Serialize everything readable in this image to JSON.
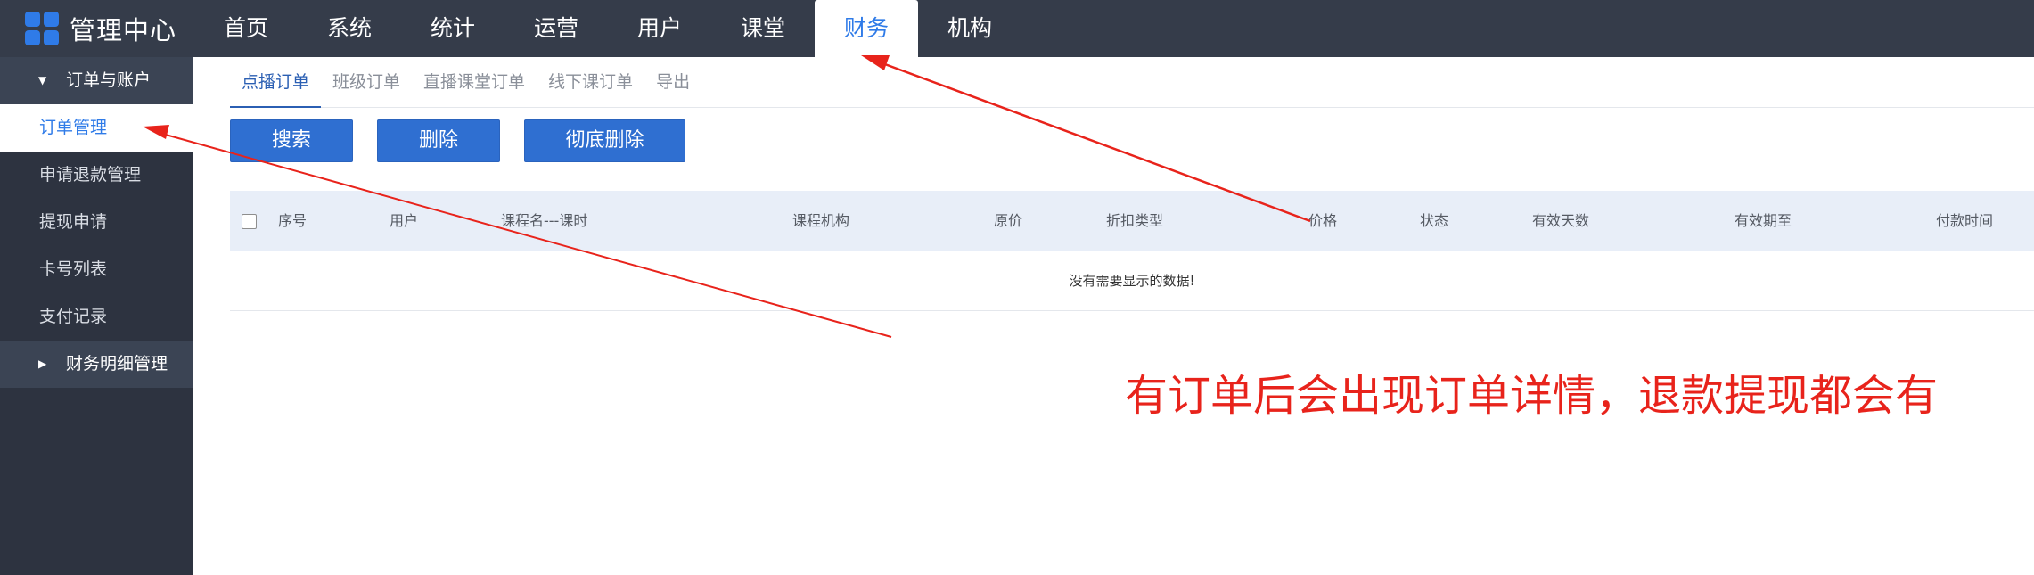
{
  "header": {
    "brand_title": "管理中心",
    "brand_icon": "app-grid-icon",
    "nav": [
      "首页",
      "系统",
      "统计",
      "运营",
      "用户",
      "课堂",
      "财务",
      "机构"
    ],
    "active_nav": "财务"
  },
  "sidebar": {
    "group_open": "订单与账户",
    "items": [
      "订单管理",
      "申请退款管理",
      "提现申请",
      "卡号列表",
      "支付记录"
    ],
    "active_item": "订单管理",
    "group_closed": "财务明细管理"
  },
  "tabs": [
    "点播订单",
    "班级订单",
    "直播课堂订单",
    "线下课订单",
    "导出"
  ],
  "active_tab": "点播订单",
  "actions": {
    "search": "搜索",
    "delete": "删除",
    "purge": "彻底删除"
  },
  "table": {
    "columns": [
      "序号",
      "用户",
      "课程名---课时",
      "课程机构",
      "原价",
      "折扣类型",
      "价格",
      "状态",
      "有效天数",
      "有效期至",
      "付款时间"
    ],
    "empty_text": "没有需要显示的数据!"
  },
  "annotation": {
    "text": "有订单后会出现订单详情，退款提现都会有",
    "color": "#e8231b"
  },
  "colors": {
    "topbar": "#353c4a",
    "sidebar": "#2d3340",
    "accent": "#2f7be8",
    "button": "#2f6fd1"
  }
}
